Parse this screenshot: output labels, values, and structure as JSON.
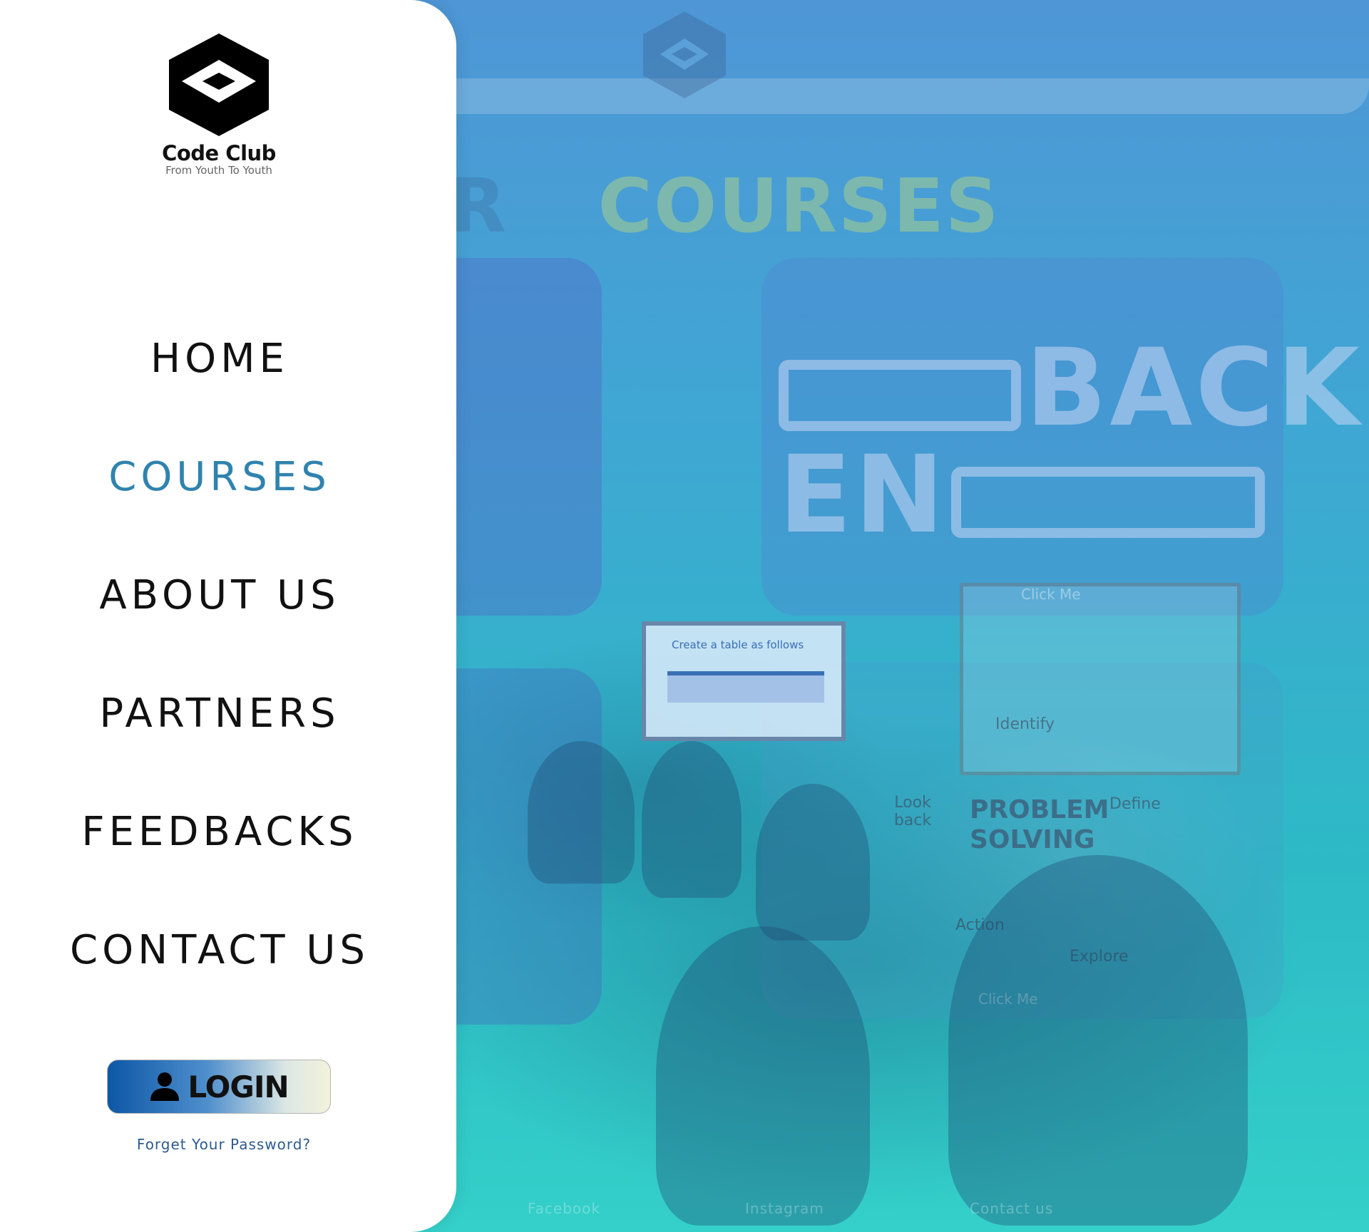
{
  "brand": {
    "name": "Code Club",
    "tagline": "From Youth To Youth",
    "logo_icon": "hexagon-diamond-logo"
  },
  "nav": {
    "items": [
      {
        "label": "HOME",
        "active": false
      },
      {
        "label": "COURSES",
        "active": true
      },
      {
        "label": "ABOUT US",
        "active": false
      },
      {
        "label": "PARTNERS",
        "active": false
      },
      {
        "label": "FEEDBACKS",
        "active": false
      },
      {
        "label": "CONTACT US",
        "active": false
      }
    ]
  },
  "auth": {
    "login_label": "LOGIN",
    "login_icon": "user-icon",
    "forgot_label": "Forget Your Password?"
  },
  "background_page": {
    "heading_partial": "R",
    "heading_main": "COURSES",
    "card_back_title": "BACK",
    "card_back_title_2": "EN",
    "click_me_1": "Click Me",
    "click_me_2": "Click Me",
    "screen_text": "Create a table as follows",
    "whiteboard_notes": {
      "identify": "Identify",
      "look_back": "Look back",
      "define": "Define",
      "problem_solving": "PROBLEM SOLVING",
      "action": "Action",
      "explore": "Explore"
    },
    "footer_links": [
      "Facebook",
      "Instagram",
      "Contact us"
    ]
  },
  "colors": {
    "active_nav": "#2f83ae",
    "nav_text": "#111111",
    "forgot_link": "#2c5a8f",
    "login_gradient_start": "#0d57a6",
    "login_gradient_end": "#f3f2dc",
    "bg_gradient_top": "#4f96d6",
    "bg_gradient_bottom": "#34d0c9"
  }
}
